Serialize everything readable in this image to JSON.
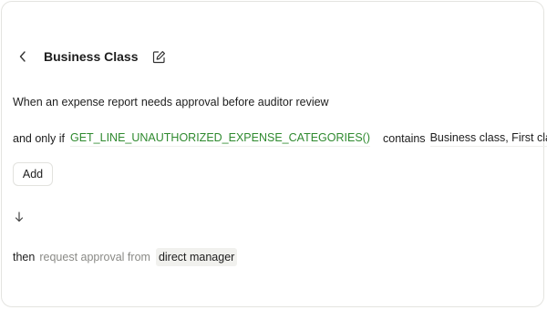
{
  "header": {
    "title": "Business Class",
    "back_icon": "chevron-left-icon",
    "edit_icon": "edit-icon"
  },
  "trigger": {
    "lead": "When an expense report",
    "condition": "needs approval before auditor review"
  },
  "condition": {
    "prefix": "and only if",
    "function": "GET_LINE_UNAUTHORIZED_EXPENSE_CATEGORIES()",
    "operator": "contains",
    "values": "Business class, First class"
  },
  "add_button": "Add",
  "flow_icon": "arrow-down-icon",
  "action": {
    "prefix": "then",
    "verb": "request approval from",
    "target": "direct manager"
  },
  "colors": {
    "function_text": "#2f8a2f",
    "muted_text": "#8a8a86",
    "pill_bg": "#f1f1ee"
  }
}
